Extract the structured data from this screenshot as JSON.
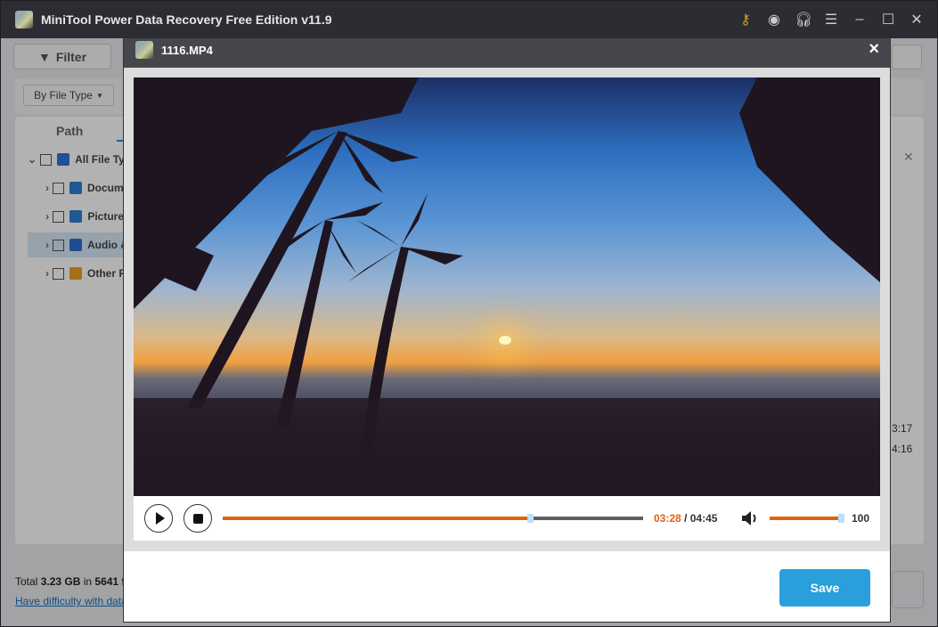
{
  "app": {
    "title": "MiniTool Power Data Recovery Free Edition v11.9",
    "icons": [
      "key-icon",
      "disc-icon",
      "headphones-icon",
      "menu-icon",
      "minimize-icon",
      "maximize-icon",
      "close-icon"
    ],
    "filter_label": "Filter",
    "file_type_select": "By File Type",
    "path_tab": "Path",
    "tree": [
      {
        "label": "All File Types",
        "icon": "computer-icon",
        "color": "#3b6fd4"
      },
      {
        "label": "Document",
        "icon": "document-icon",
        "color": "#2f7fd6"
      },
      {
        "label": "Picture",
        "icon": "picture-icon",
        "color": "#2f7fd6"
      },
      {
        "label": "Audio & Video",
        "icon": "audio-video-icon",
        "color": "#2f6fd0"
      },
      {
        "label": "Other Files",
        "icon": "folder-icon",
        "color": "#f0a020"
      }
    ],
    "right_times": [
      "3:17",
      "4:16"
    ],
    "footer": {
      "total_prefix": "Total ",
      "total_size": "3.23 GB",
      "total_mid": " in ",
      "total_count": "5641 f",
      "help_link": "Have difficulty with data"
    }
  },
  "preview": {
    "title": "1116.MP4",
    "close": "×",
    "player": {
      "current_time": "03:28",
      "duration": "04:45",
      "separator": " / ",
      "progress_percent": 73,
      "volume": "100",
      "volume_percent": 100,
      "accent": "#e0620d"
    },
    "save_label": "Save",
    "save_color": "#29a0dc"
  }
}
